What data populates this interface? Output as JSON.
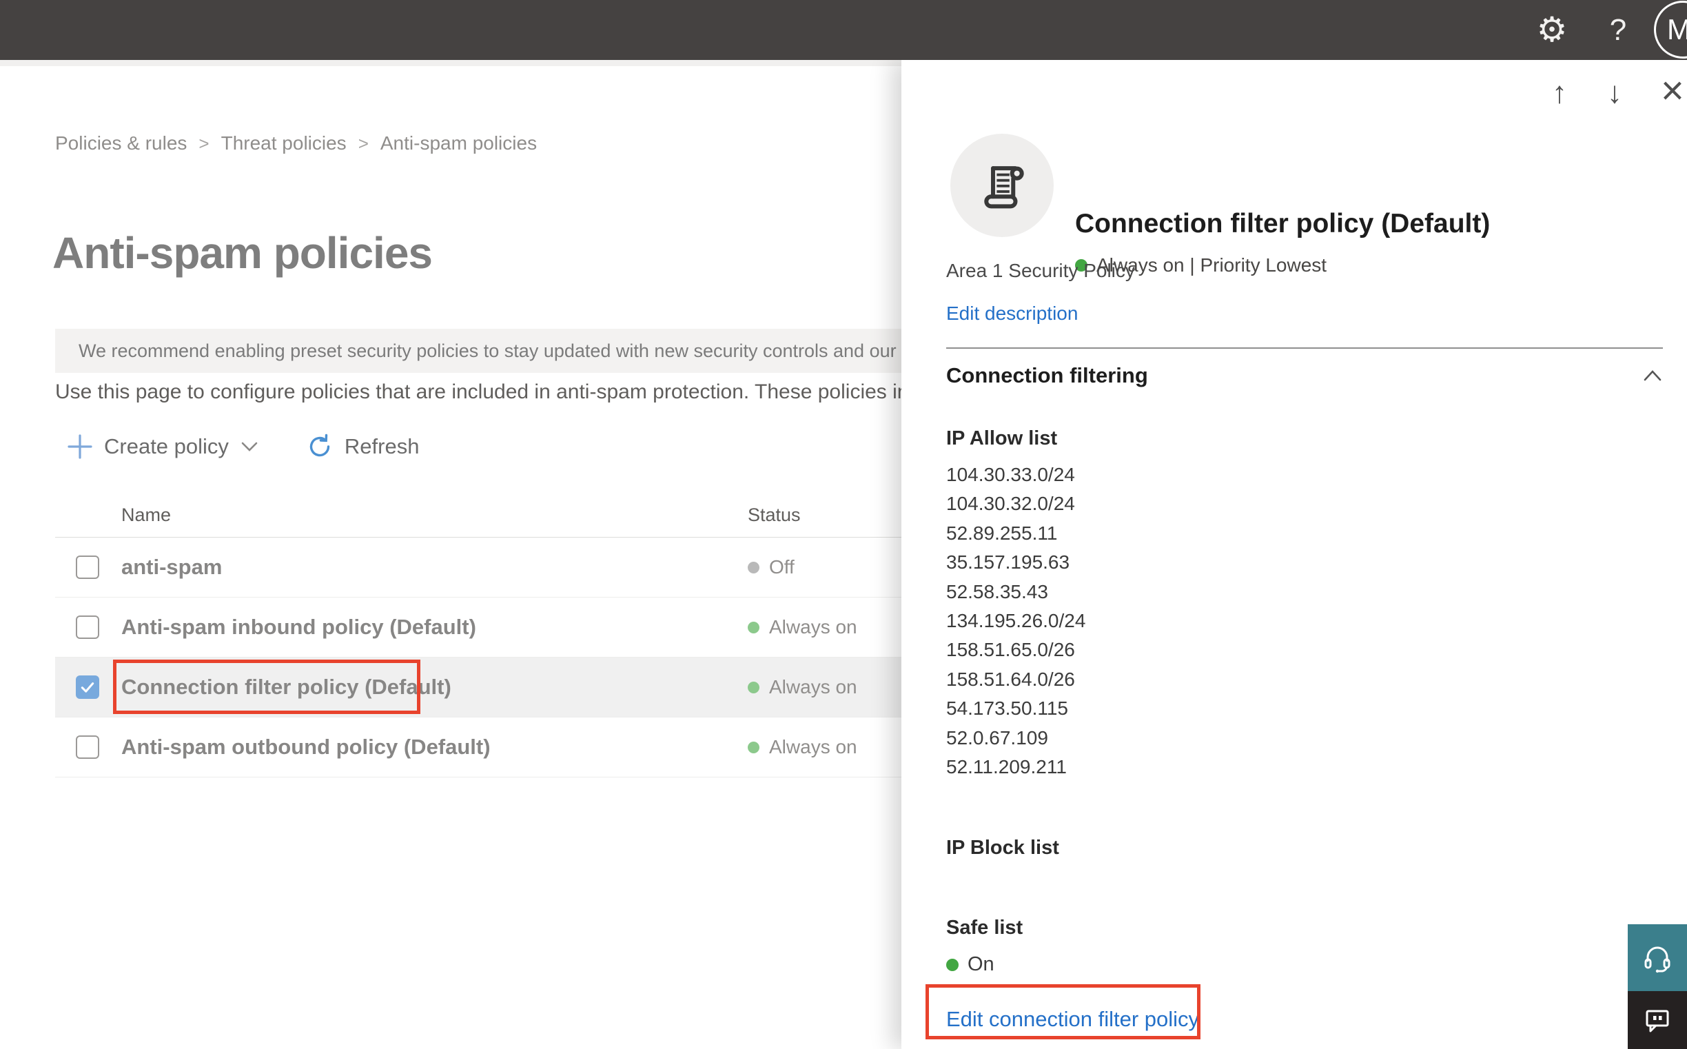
{
  "topbar": {
    "settings_glyph": "⚙",
    "help_glyph": "?",
    "avatar_initial": "M"
  },
  "breadcrumb": {
    "items": [
      "Policies & rules",
      "Threat policies",
      "Anti-spam policies"
    ],
    "separator": ">"
  },
  "page": {
    "title": "Anti-spam policies",
    "banner_text": "We recommend enabling preset security policies to stay updated with new security controls and our recommended settings.",
    "description": "Use this page to configure policies that are included in anti-spam protection. These policies include"
  },
  "toolbar": {
    "create_policy_label": "Create policy",
    "refresh_label": "Refresh"
  },
  "table": {
    "columns": [
      "Name",
      "Status"
    ],
    "rows": [
      {
        "name": "anti-spam",
        "status": "Off",
        "state": "off",
        "selected": false
      },
      {
        "name": "Anti-spam inbound policy (Default)",
        "status": "Always on",
        "state": "on",
        "selected": false
      },
      {
        "name": "Connection filter policy (Default)",
        "status": "Always on",
        "state": "on",
        "selected": true,
        "annotated": true
      },
      {
        "name": "Anti-spam outbound policy (Default)",
        "status": "Always on",
        "state": "on",
        "selected": false
      }
    ]
  },
  "panel": {
    "nav": {
      "up_glyph": "↑",
      "down_glyph": "↓",
      "close_glyph": "×"
    },
    "title": "Connection filter policy (Default)",
    "status_line": "Always on | Priority Lowest",
    "description": "Area 1 Security Policy",
    "edit_description_label": "Edit description",
    "section_title": "Connection filtering",
    "ip_allow_label": "IP Allow list",
    "ip_allow_items": [
      "104.30.33.0/24",
      "104.30.32.0/24",
      "52.89.255.11",
      "35.157.195.63",
      "52.58.35.43",
      "134.195.26.0/24",
      "158.51.65.0/26",
      "158.51.64.0/26",
      "54.173.50.115",
      "52.0.67.109",
      "52.11.209.211"
    ],
    "ip_block_label": "IP Block list",
    "safe_list_label": "Safe list",
    "safe_list_status": "On",
    "edit_link_label": "Edit connection filter policy"
  },
  "colors": {
    "topbar_bg": "#454241",
    "link_blue": "#2470c8",
    "annotation_red": "#e8432d",
    "table_dot_on": "#8cc98c",
    "table_dot_off": "#b9b9b9",
    "panel_dot_on": "#42a642",
    "selected_checkbox_blue": "#78a9dd",
    "selected_row_bg": "#f0f0f0",
    "support_teal": "#3b7f8c",
    "feedback_dark": "#252121"
  }
}
